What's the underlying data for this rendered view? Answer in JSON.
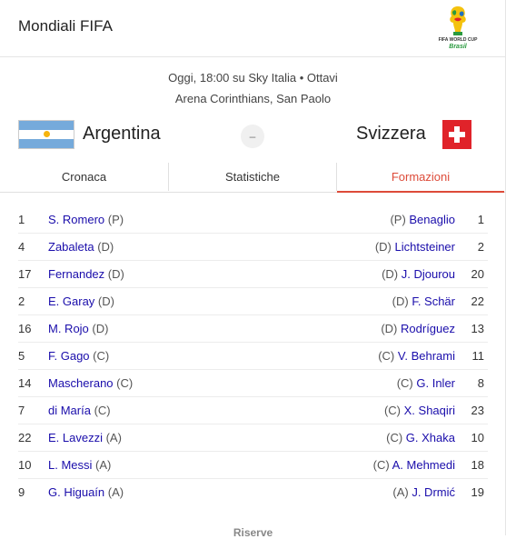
{
  "header": {
    "title": "Mondiali FIFA",
    "logo_text": "FIFA WORLD CUP",
    "logo_script": "Brasil"
  },
  "match": {
    "info_line1": "Oggi, 18:00 su Sky Italia • Ottavi",
    "info_line2": "Arena Corinthians, San Paolo",
    "home_team": "Argentina",
    "away_team": "Svizzera",
    "score": "–"
  },
  "tabs": [
    {
      "label": "Cronaca"
    },
    {
      "label": "Statistiche"
    },
    {
      "label": "Formazioni",
      "active": true
    }
  ],
  "lineup": {
    "rows": [
      {
        "home_num": "1",
        "home_name": "S. Romero",
        "home_role": " (P)",
        "away_role": "(P) ",
        "away_name": "Benaglio",
        "away_num": "1"
      },
      {
        "home_num": "4",
        "home_name": "Zabaleta",
        "home_role": " (D)",
        "away_role": "(D) ",
        "away_name": "Lichtsteiner",
        "away_num": "2"
      },
      {
        "home_num": "17",
        "home_name": "Fernandez",
        "home_role": " (D)",
        "away_role": "(D) ",
        "away_name": "J. Djourou",
        "away_num": "20"
      },
      {
        "home_num": "2",
        "home_name": "E. Garay",
        "home_role": " (D)",
        "away_role": "(D) ",
        "away_name": "F. Schär",
        "away_num": "22"
      },
      {
        "home_num": "16",
        "home_name": "M. Rojo",
        "home_role": " (D)",
        "away_role": "(D) ",
        "away_name": "Rodríguez",
        "away_num": "13"
      },
      {
        "home_num": "5",
        "home_name": "F. Gago",
        "home_role": " (C)",
        "away_role": "(C) ",
        "away_name": "V. Behrami",
        "away_num": "11"
      },
      {
        "home_num": "14",
        "home_name": "Mascherano",
        "home_role": " (C)",
        "away_role": "(C) ",
        "away_name": "G. Inler",
        "away_num": "8"
      },
      {
        "home_num": "7",
        "home_name": "di María",
        "home_role": " (C)",
        "away_role": "(C) ",
        "away_name": "X. Shaqiri",
        "away_num": "23"
      },
      {
        "home_num": "22",
        "home_name": "E. Lavezzi",
        "home_role": " (A)",
        "away_role": "(C) ",
        "away_name": "G. Xhaka",
        "away_num": "10"
      },
      {
        "home_num": "10",
        "home_name": "L. Messi",
        "home_role": " (A)",
        "away_role": "(C) ",
        "away_name": "A. Mehmedi",
        "away_num": "18"
      },
      {
        "home_num": "9",
        "home_name": "G. Higuaín",
        "home_role": " (A)",
        "away_role": "(A) ",
        "away_name": "J. Drmić",
        "away_num": "19"
      }
    ]
  },
  "section_next": "Riserve",
  "colors": {
    "accent": "#dd4b39",
    "link": "#1a0dab",
    "argentina_blue": "#75aadb",
    "swiss_red": "#e0232a"
  },
  "icons": {
    "logo": "fifa-world-cup-2014-logo",
    "home_flag": "argentina-flag-icon",
    "away_flag": "switzerland-flag-icon"
  }
}
